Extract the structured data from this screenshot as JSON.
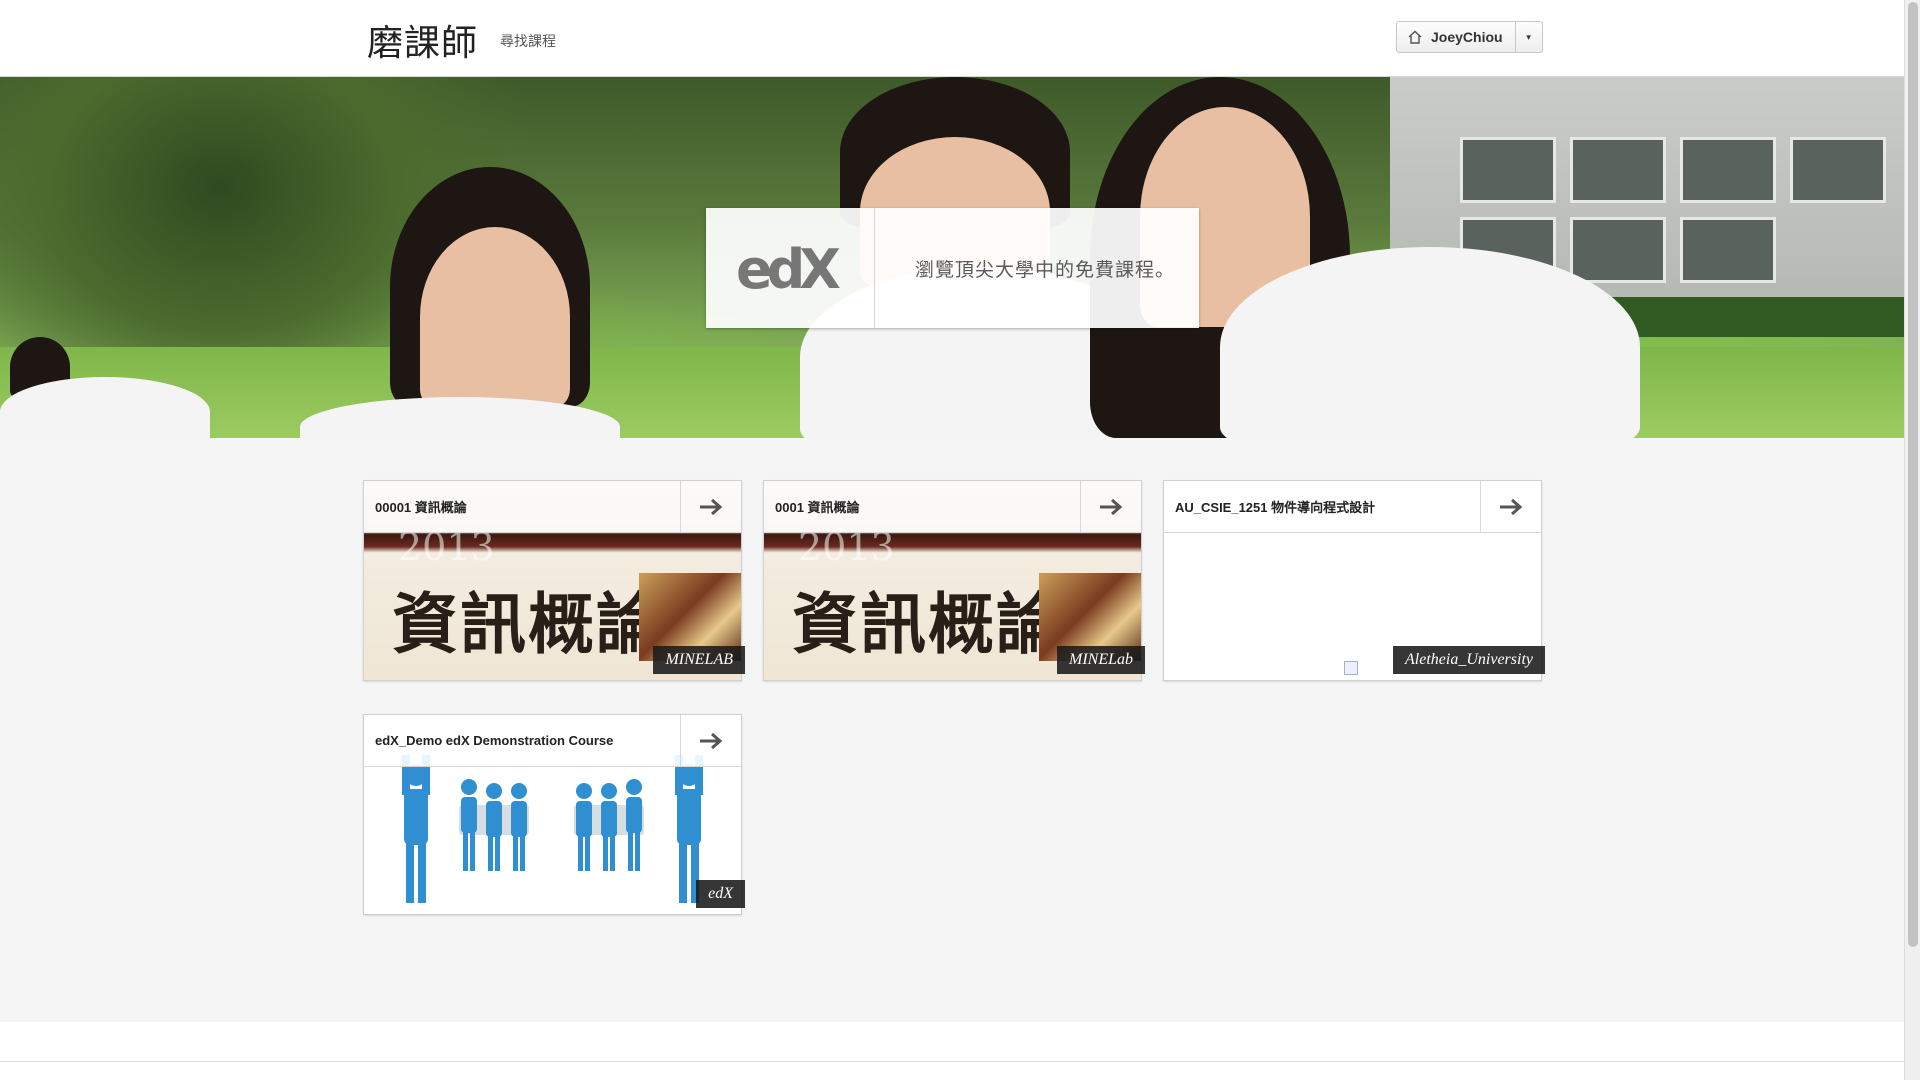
{
  "header": {
    "logo": "磨課師",
    "nav_link": "尋找課程",
    "username": "JoeyChiou",
    "dropdown_caret": "▾"
  },
  "hero": {
    "logo_text": "edX",
    "tagline": "瀏覽頂尖大學中的免費課程。"
  },
  "courses": [
    {
      "title": "00001 資訊概論",
      "org": "MINELAB",
      "cover_title": "資訊概論",
      "cover_year": "2013"
    },
    {
      "title": "0001 資訊概論",
      "org": "MINELab",
      "cover_title": "資訊概論",
      "cover_year": "2013"
    },
    {
      "title": "AU_CSIE_1251 物件導向程式設計",
      "org": "Aletheia_University"
    },
    {
      "title": "edX_Demo edX Demonstration Course",
      "org": "edX"
    }
  ],
  "colors": {
    "page_bg": "#f5f5f5",
    "org_badge_bg": "#1a1a1a",
    "demo_figure": "#2f8fd0"
  }
}
